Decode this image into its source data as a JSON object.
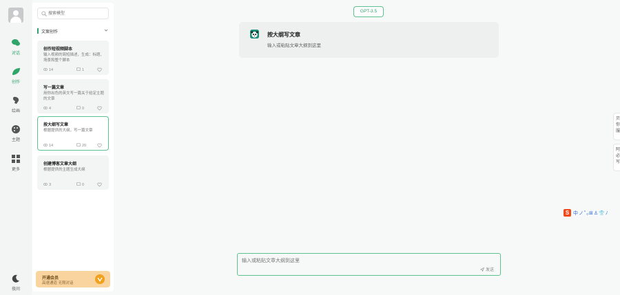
{
  "rail": {
    "items": [
      {
        "label": "对话",
        "icon": "chat-icon",
        "active": true
      },
      {
        "label": "创作",
        "icon": "leaf-icon",
        "active": true
      },
      {
        "label": "绘画",
        "icon": "brush-icon",
        "active": false
      },
      {
        "label": "主题",
        "icon": "palette-icon",
        "active": false
      },
      {
        "label": "更多",
        "icon": "grid-icon",
        "active": false
      }
    ],
    "theme_label": "夜间"
  },
  "panel": {
    "search_placeholder": "搜索模型",
    "category": "文案创作",
    "cards": [
      {
        "title": "创作短视频脚本",
        "desc": "输入视频的简短描述，生成：标题、场景和整个脚本",
        "views": "14",
        "chats": "1"
      },
      {
        "title": "写一篇文章",
        "desc": "用你出色的英文写一篇关于给定主题的文章",
        "views": "4",
        "chats": "0"
      },
      {
        "title": "按大纲写文章",
        "desc": "根据提供的大纲，写一篇文章",
        "views": "14",
        "chats": "20"
      },
      {
        "title": "创建博客文章大纲",
        "desc": "根据提供的主题生成大纲",
        "views": "3",
        "chats": "0"
      }
    ],
    "vip": {
      "title": "开通会员",
      "subtitle": "高速通道 无限对话"
    }
  },
  "main": {
    "model": "GPT-3.5",
    "info": {
      "title": "按大纲写文章",
      "desc": "输入或粘贴文章大纲到这里"
    },
    "composer": {
      "placeholder": "输入或粘贴文章大纲到这里",
      "send_label": "发送"
    }
  },
  "edge": {
    "tab1": "贝你服",
    "tab2": "阿必写"
  },
  "ime": {
    "logo": "S",
    "items": "中ノ˚ₒ⊞♙👕ﾉ"
  },
  "colors": {
    "accent": "#2fa56a",
    "vip": "#f9d49e"
  }
}
